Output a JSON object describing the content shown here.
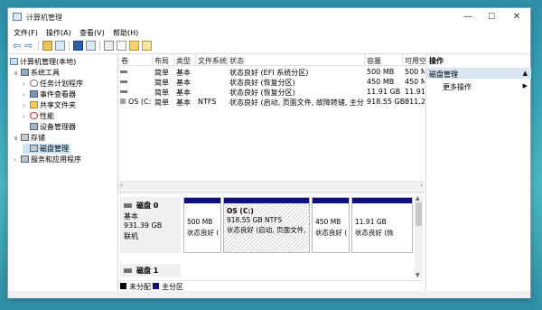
{
  "window": {
    "title": "计算机管理",
    "controls": {
      "minimize": "—",
      "maximize": "☐",
      "close": "✕"
    }
  },
  "menubar": [
    {
      "label": "文件(F)"
    },
    {
      "label": "操作(A)"
    },
    {
      "label": "查看(V)"
    },
    {
      "label": "帮助(H)"
    }
  ],
  "toolbar": {
    "back_glyph": "⇦",
    "forward_glyph": "⇨"
  },
  "tree": [
    {
      "label": "计算机管理(本地)",
      "expander": "",
      "icon": "computer-icon"
    },
    {
      "label": "系统工具",
      "expander": "∨",
      "icon": "tools-icon"
    },
    {
      "label": "任务计划程序",
      "expander": "›",
      "icon": "clock-icon"
    },
    {
      "label": "事件查看器",
      "expander": "›",
      "icon": "event-viewer-icon"
    },
    {
      "label": "共享文件夹",
      "expander": "›",
      "icon": "shared-folder-icon"
    },
    {
      "label": "性能",
      "expander": "›",
      "icon": "performance-icon"
    },
    {
      "label": "设备管理器",
      "expander": "",
      "icon": "device-manager-icon"
    },
    {
      "label": "存储",
      "expander": "∨",
      "icon": "storage-icon"
    },
    {
      "label": "磁盘管理",
      "expander": "",
      "icon": "disk-icon"
    },
    {
      "label": "服务和应用程序",
      "expander": "›",
      "icon": "services-icon"
    }
  ],
  "volume_table": {
    "columns": [
      "卷",
      "布局",
      "类型",
      "文件系统",
      "状态",
      "容量",
      "可用空"
    ],
    "rows": [
      {
        "volume": "",
        "layout": "简单",
        "type": "基本",
        "fs": "",
        "status": "状态良好 (EFI 系统分区)",
        "capacity": "500 MB",
        "free": "500 M"
      },
      {
        "volume": "",
        "layout": "简单",
        "type": "基本",
        "fs": "",
        "status": "状态良好 (恢复分区)",
        "capacity": "450 MB",
        "free": "450 M"
      },
      {
        "volume": "",
        "layout": "简单",
        "type": "基本",
        "fs": "",
        "status": "状态良好 (恢复分区)",
        "capacity": "11.91 GB",
        "free": "11.91"
      },
      {
        "volume": "OS (C:)",
        "layout": "简单",
        "type": "基本",
        "fs": "NTFS",
        "status": "状态良好 (启动, 页面文件, 故障转储, 主分区)",
        "capacity": "918.55 GB",
        "free": "811.2"
      }
    ]
  },
  "disk0": {
    "name": "磁盘 0",
    "type": "基本",
    "size": "931.39 GB",
    "status": "联机",
    "partitions": [
      {
        "title": "",
        "size": "500 MB",
        "status": "状态良好 ("
      },
      {
        "title": "OS  (C:)",
        "size": "918.55 GB NTFS",
        "status": "状态良好 (启动, 页面文件, 故"
      },
      {
        "title": "",
        "size": "450 MB",
        "status": "状态良好 ("
      },
      {
        "title": "",
        "size": "11.91 GB",
        "status": "状态良好 (恢"
      }
    ]
  },
  "disk1": {
    "name": "磁盘 1"
  },
  "legend": [
    {
      "label": "未分配",
      "color": "#000000"
    },
    {
      "label": "主分区",
      "color": "#0c0f7d"
    }
  ],
  "actions": {
    "header": "操作",
    "section": "磁盘管理",
    "section_arrow": "▲",
    "item": "更多操作",
    "item_arrow": "▶"
  }
}
